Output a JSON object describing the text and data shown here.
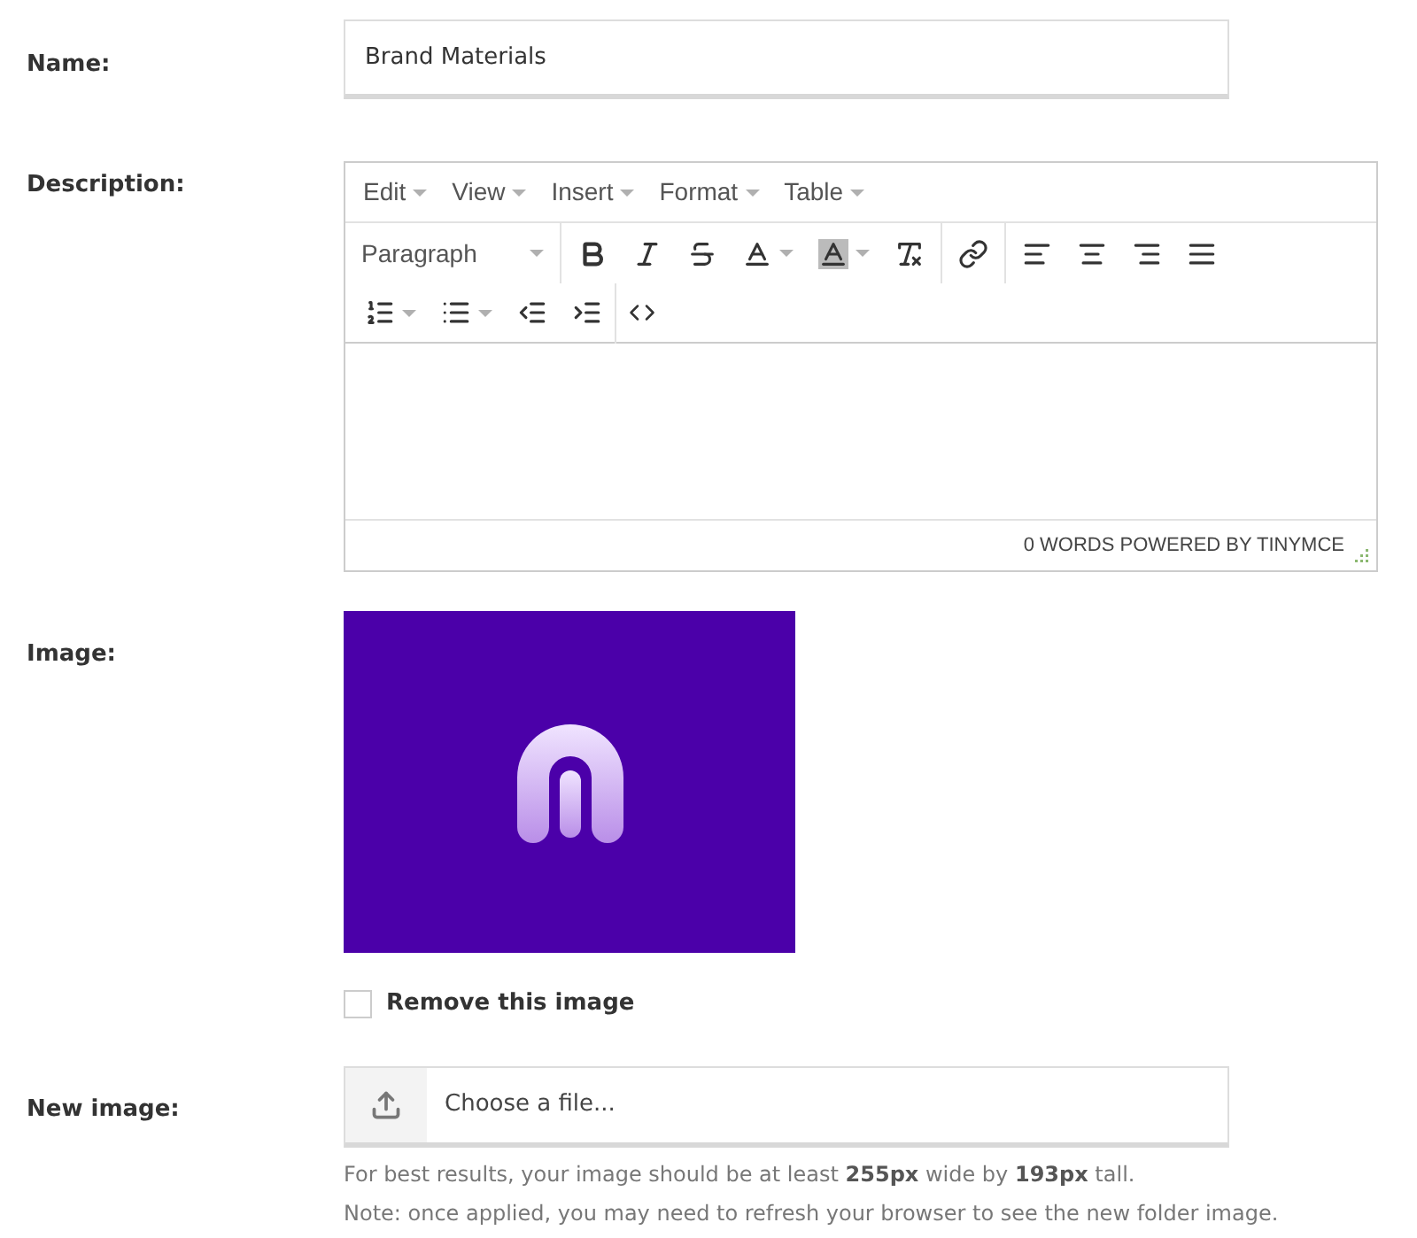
{
  "name_field": {
    "label": "Name:",
    "value": "Brand Materials"
  },
  "description": {
    "label": "Description:",
    "menus": [
      "Edit",
      "View",
      "Insert",
      "Format",
      "Table"
    ],
    "block_format": "Paragraph",
    "status": "0 WORDS POWERED BY TINYMCE"
  },
  "image": {
    "label": "Image:",
    "remove": {
      "label": "Remove this image",
      "checked": false
    }
  },
  "new_image": {
    "label": "New image:",
    "placeholder": "Choose a file...",
    "notes": [
      "For best results, your image should be at least **255px** wide by **193px** tall.",
      "Note: once applied, you may need to refresh your browser to see the new folder image."
    ]
  }
}
